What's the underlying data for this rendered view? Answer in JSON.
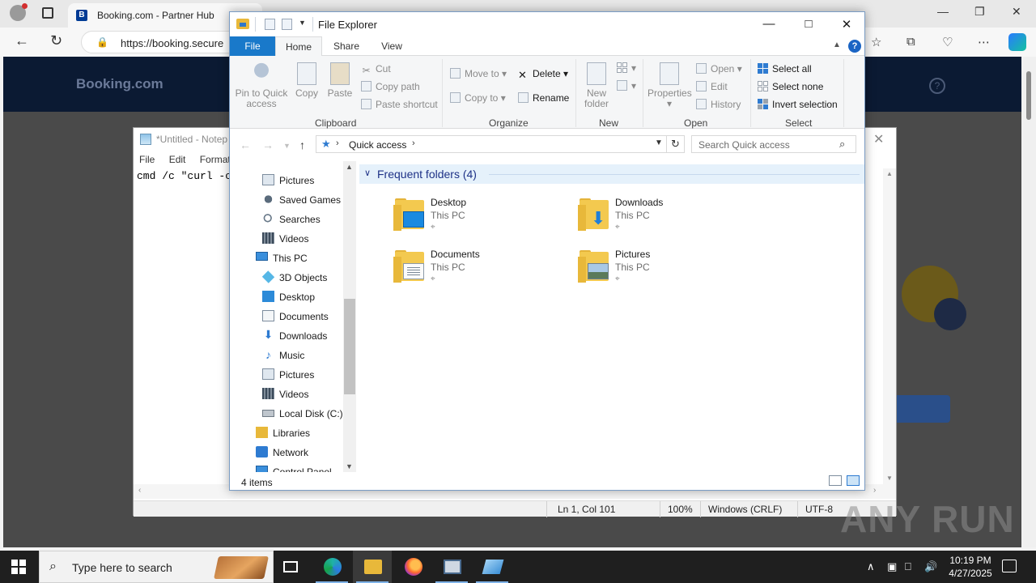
{
  "browser": {
    "tab_title": "Booking.com - Partner Hub",
    "favicon_letter": "B",
    "url_host": "https://booking.secure",
    "page_logo": "Booking.com",
    "help_glyph": "?"
  },
  "notepad": {
    "title": "*Untitled - Notep",
    "menu": [
      "File",
      "Edit",
      "Format"
    ],
    "text": "cmd /c \"curl -c",
    "status": {
      "position": "Ln 1, Col 101",
      "zoom": "100%",
      "line_ending": "Windows (CRLF)",
      "encoding": "UTF-8"
    }
  },
  "explorer": {
    "title": "File Explorer",
    "tabs": {
      "file": "File",
      "home": "Home",
      "share": "Share",
      "view": "View"
    },
    "ribbon": {
      "clipboard": {
        "label": "Clipboard",
        "pin": "Pin to Quick access",
        "copy": "Copy",
        "paste": "Paste",
        "cut": "Cut",
        "copy_path": "Copy path",
        "paste_shortcut": "Paste shortcut"
      },
      "organize": {
        "label": "Organize",
        "move_to": "Move to",
        "copy_to": "Copy to",
        "delete": "Delete",
        "rename": "Rename"
      },
      "new": {
        "label": "New",
        "new_folder": "New folder"
      },
      "open": {
        "label": "Open",
        "properties": "Properties",
        "open": "Open",
        "edit": "Edit",
        "history": "History"
      },
      "select": {
        "label": "Select",
        "select_all": "Select all",
        "select_none": "Select none",
        "invert": "Invert selection"
      }
    },
    "address": {
      "location": "Quick access"
    },
    "search": {
      "placeholder": "Search Quick access"
    },
    "tree": [
      {
        "label": "Pictures",
        "icon": "pictures-icon",
        "indent": 1
      },
      {
        "label": "Saved Games",
        "icon": "saved-games-icon",
        "indent": 1
      },
      {
        "label": "Searches",
        "icon": "searches-icon",
        "indent": 1
      },
      {
        "label": "Videos",
        "icon": "videos-icon",
        "indent": 1
      },
      {
        "label": "This PC",
        "icon": "this-pc-icon",
        "indent": 0
      },
      {
        "label": "3D Objects",
        "icon": "3d-objects-icon",
        "indent": 1
      },
      {
        "label": "Desktop",
        "icon": "desktop-icon",
        "indent": 1
      },
      {
        "label": "Documents",
        "icon": "documents-icon",
        "indent": 1
      },
      {
        "label": "Downloads",
        "icon": "downloads-icon",
        "indent": 1
      },
      {
        "label": "Music",
        "icon": "music-icon",
        "indent": 1
      },
      {
        "label": "Pictures",
        "icon": "pictures-icon",
        "indent": 1
      },
      {
        "label": "Videos",
        "icon": "videos-icon",
        "indent": 1
      },
      {
        "label": "Local Disk (C:)",
        "icon": "local-disk-icon",
        "indent": 1
      },
      {
        "label": "Libraries",
        "icon": "libraries-icon",
        "indent": 0
      },
      {
        "label": "Network",
        "icon": "network-icon",
        "indent": 0
      },
      {
        "label": "Control Panel",
        "icon": "control-panel-icon",
        "indent": 0
      }
    ],
    "group_title": "Frequent folders (4)",
    "folders": [
      {
        "name": "Desktop",
        "location": "This PC",
        "badge": "desktop"
      },
      {
        "name": "Downloads",
        "location": "This PC",
        "badge": "downloads"
      },
      {
        "name": "Documents",
        "location": "This PC",
        "badge": "documents"
      },
      {
        "name": "Pictures",
        "location": "This PC",
        "badge": "pictures"
      }
    ],
    "status_count": "4 items"
  },
  "taskbar": {
    "search_placeholder": "Type here to search",
    "time": "10:19 PM",
    "date": "4/27/2025"
  },
  "watermark": "ANY RUN",
  "colors": {
    "accent": "#1979ca",
    "group_header_text": "#1e3287",
    "folder_yellow": "#f3c94f",
    "taskbar": "#1f1f1f"
  }
}
